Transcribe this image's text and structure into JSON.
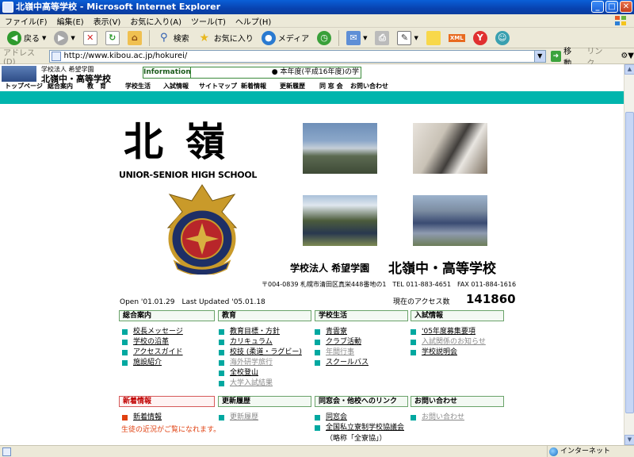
{
  "window": {
    "title": "北嶺中高等学校 - Microsoft Internet Explorer",
    "min": "_",
    "max": "□",
    "close": "✕"
  },
  "menu": [
    "ファイル(F)",
    "編集(E)",
    "表示(V)",
    "お気に入り(A)",
    "ツール(T)",
    "ヘルプ(H)"
  ],
  "toolbar": {
    "back": "戻る",
    "search": "検索",
    "favorites": "お気に入り",
    "media": "メディア",
    "xml": "XML"
  },
  "address": {
    "label": "アドレス(D)",
    "url": "http://www.kibou.ac.jp/hokurei/",
    "go": "移動",
    "links": "リンク"
  },
  "site": {
    "corp_small": "学校法人 希望学園",
    "name_small": "北嶺中・高等学校",
    "info_tag": "Information",
    "ticker": "● 本年度(平成16年度)の学",
    "nav": [
      "トップページ",
      "総合案内",
      "教　育",
      "学校生活",
      "入試情報",
      "サイトマップ",
      "新着情報",
      "更新履歴",
      "同 窓 会",
      "お問い合わせ"
    ]
  },
  "hero": {
    "kanji": "北嶺",
    "english": "UNIOR-SENIOR HIGH SCHOOL",
    "corp": "学校法人 希望学園",
    "school": "北嶺中・高等学校",
    "address": "〒004-0839 札幌市清田区真栄448番地の1　TEL 011-883-4651　FAX 011-884-1616",
    "open": "Open '01.01.29　Last Updated '05.01.18",
    "access_label": "現在のアクセス数",
    "access_count": "141860"
  },
  "categories": [
    {
      "title": "総合案内",
      "items": [
        {
          "label": "校長メッセージ",
          "gray": false
        },
        {
          "label": "学校の沿革",
          "gray": false
        },
        {
          "label": "アクセスガイド",
          "gray": false
        },
        {
          "label": "施設紹介",
          "gray": false
        }
      ]
    },
    {
      "title": "教育",
      "items": [
        {
          "label": "教育目標・方針",
          "gray": false
        },
        {
          "label": "カリキュラム",
          "gray": false
        },
        {
          "label": "校技 (柔道・ラグビー)",
          "gray": false
        },
        {
          "label": "海外研学旅行",
          "gray": true
        },
        {
          "label": "全校登山",
          "gray": false
        },
        {
          "label": "大学入試結果",
          "gray": true
        }
      ]
    },
    {
      "title": "学校生活",
      "items": [
        {
          "label": "青雲寮",
          "gray": false
        },
        {
          "label": "クラブ活動",
          "gray": false
        },
        {
          "label": "年間行事",
          "gray": true
        },
        {
          "label": "スクールバス",
          "gray": false
        }
      ]
    },
    {
      "title": "入試情報",
      "items": [
        {
          "label": "'05年度募集要項",
          "gray": false
        },
        {
          "label": "入試関係のお知らせ",
          "gray": true
        },
        {
          "label": "学校説明会",
          "gray": false
        }
      ]
    },
    {
      "title": "新着情報",
      "items": [
        {
          "label": "新着情報",
          "gray": false
        }
      ]
    },
    {
      "title": "更新履歴",
      "items": [
        {
          "label": "更新履歴",
          "gray": true
        }
      ]
    },
    {
      "title": "同窓会・他校へのリンク",
      "items": [
        {
          "label": "同窓会",
          "gray": false
        },
        {
          "label": "全国私立寮制学校協議会",
          "gray": false
        }
      ]
    },
    {
      "title": "お問い合わせ",
      "items": [
        {
          "label": "お問い合わせ",
          "gray": true
        }
      ]
    }
  ],
  "news_note": "生徒の近況がご覧になれます。",
  "association_note": "（略称「全寮協」）",
  "status": {
    "zone": "インターネット"
  },
  "colors": {
    "teal": "#00b5ad",
    "bullet": "#00a8a0",
    "news_red": "#e04010"
  }
}
